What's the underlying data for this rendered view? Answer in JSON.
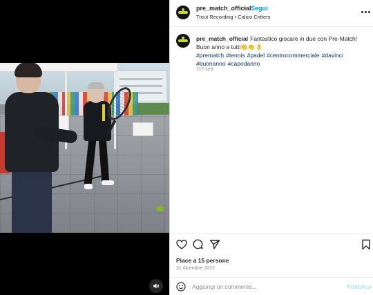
{
  "post": {
    "username": "pre_match_official",
    "separator": "•",
    "follow_label": "Segui",
    "audio": "Trout Recording • Calico Critters",
    "caption_user": "pre_match_official",
    "caption_text": "Fantastico giocare in due con Pre-Match! Buon anno a tutti👏👏👌",
    "hashtags": [
      "#prematch",
      "#tennis",
      "#padel",
      "#centrocommerciale",
      "#davinci",
      "#buonanno",
      "#capodanno"
    ],
    "time_ago": "117 sett",
    "likes": "Piace a 15 persone",
    "date": "31 dicembre 2022"
  },
  "comment": {
    "placeholder": "Aggiungi un commento...",
    "publish_label": "Pubblica"
  },
  "icons": {
    "more": "more-options-icon",
    "like": "heart-icon",
    "comment": "comment-icon",
    "share": "share-icon",
    "save": "bookmark-icon",
    "emoji": "emoji-icon",
    "mute": "mute-icon"
  },
  "colors": {
    "follow": "#0095f6",
    "hashtag": "#00376b",
    "publish_disabled": "#b2dffc",
    "muted_text": "#8e8e8e",
    "avatar_accent": "#c6d82a"
  }
}
